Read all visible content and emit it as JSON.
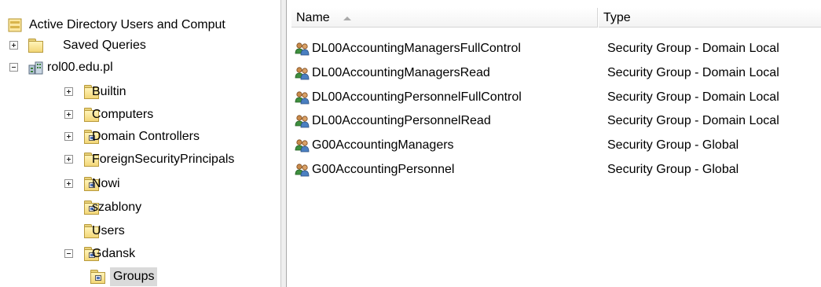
{
  "tree": {
    "root_label": "Active Directory Users and Comput",
    "saved_queries": "Saved Queries",
    "domain": "rol00.edu.pl",
    "builtin": "Builtin",
    "computers": "Computers",
    "domain_controllers": "Domain Controllers",
    "foreign_security_principals": "ForeignSecurityPrincipals",
    "nowi": "Nowi",
    "szablony": "szablony",
    "users": "Users",
    "gdansk": "Gdansk",
    "groups": "Groups"
  },
  "list": {
    "columns": {
      "name": "Name",
      "type": "Type"
    },
    "rows": [
      {
        "name": "DL00AccountingManagersFullControl",
        "type": "Security Group - Domain Local"
      },
      {
        "name": "DL00AccountingManagersRead",
        "type": "Security Group - Domain Local"
      },
      {
        "name": "DL00AccountingPersonnelFullControl",
        "type": "Security Group - Domain Local"
      },
      {
        "name": "DL00AccountingPersonnelRead",
        "type": "Security Group - Domain Local"
      },
      {
        "name": "G00AccountingManagers",
        "type": "Security Group - Global"
      },
      {
        "name": "G00AccountingPersonnel",
        "type": "Security Group - Global"
      }
    ],
    "sorted_by": "name",
    "sort_direction": "ascending"
  },
  "icons": {
    "root": "active-directory-icon",
    "domain": "domain-icon",
    "container": "folder-icon",
    "ou": "organizational-unit-icon",
    "group": "security-group-icon"
  },
  "colors": {
    "selection": "#dadada",
    "folder": "#f3d778"
  }
}
